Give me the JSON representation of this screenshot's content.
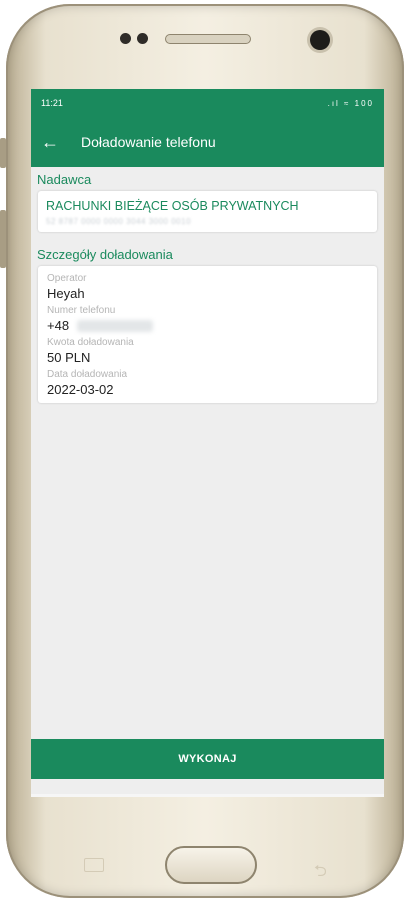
{
  "status_bar": {
    "time": "11:21",
    "icons": ".ıl ≈ 100"
  },
  "app_bar": {
    "back_icon": "←",
    "title": "Doładowanie telefonu"
  },
  "sender": {
    "section_label": "Nadawca",
    "account_name": "RACHUNKI BIEŻĄCE OSÓB PRYWATNYCH",
    "account_number": "52 8787 0000 0000 3044 3000 0010"
  },
  "details": {
    "section_label": "Szczegóły doładowania",
    "operator_label": "Operator",
    "operator_value": "Heyah",
    "phone_label": "Numer telefonu",
    "phone_prefix": "+48",
    "amount_label": "Kwota doładowania",
    "amount_value": "50 PLN",
    "date_label": "Data doładowania",
    "date_value": "2022-03-02"
  },
  "execute_button": {
    "label": "WYKONAJ"
  },
  "colors": {
    "brand": "#1a8a5d",
    "background": "#eeeeee"
  }
}
